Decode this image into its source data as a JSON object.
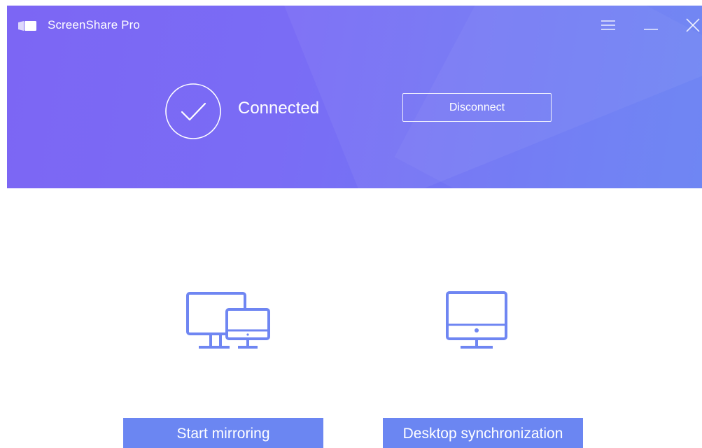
{
  "window": {
    "title": "ScreenShare Pro",
    "logo_icon": "screen-logo-icon",
    "menu_icon": "hamburger-menu-icon",
    "minimize_icon": "minimize-icon",
    "close_icon": "close-icon"
  },
  "status": {
    "icon": "check-circle-icon",
    "text": "Connected"
  },
  "header": {
    "disconnect_label": "Disconnect"
  },
  "actions": [
    {
      "icon": "dual-monitor-icon",
      "label": "Start mirroring"
    },
    {
      "icon": "desktop-monitor-icon",
      "label": "Desktop synchronization"
    }
  ],
  "colors": {
    "header_gradient_start": "#7c66f4",
    "header_gradient_end": "#6a82f3",
    "accent": "#6b86f2",
    "icon_stroke": "#6f86f2",
    "background": "#ffffff"
  }
}
